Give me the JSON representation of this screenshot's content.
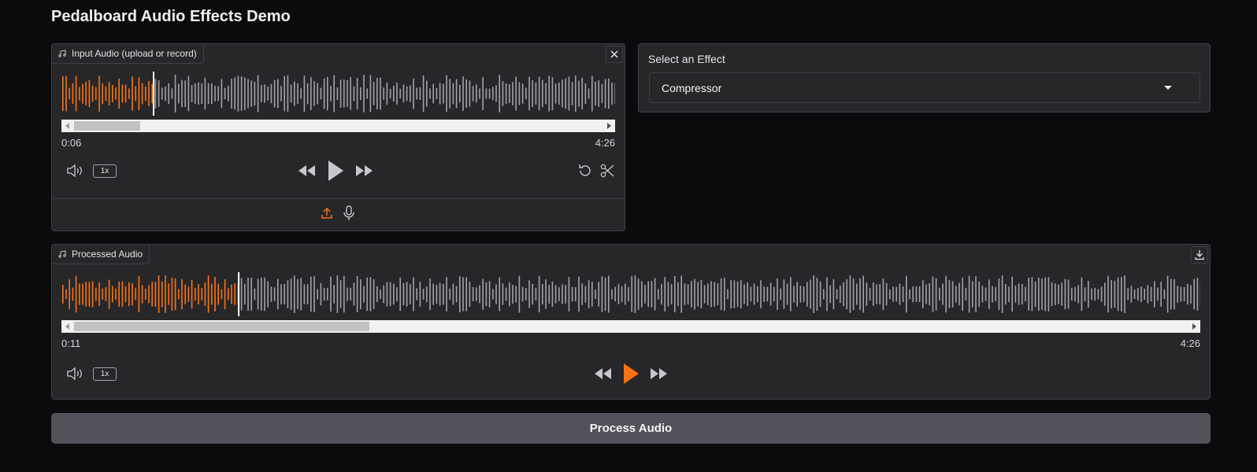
{
  "page": {
    "title": "Pedalboard Audio Effects Demo"
  },
  "colors": {
    "accent": "#f97316",
    "played": "#f97316",
    "unplayed": "#a1a1aa",
    "panel": "#27272a",
    "background": "#0b0b0d"
  },
  "input_audio": {
    "label": "Input Audio (upload or record)",
    "label_icon": "music-note-icon",
    "clear_icon": "close-icon",
    "current_time": "0:06",
    "duration": "4:26",
    "playback_rate": "1x",
    "played_fraction": 0.165,
    "scroll_thumb_fraction": 0.125,
    "controls": [
      "volume-icon",
      "skip-backward-icon",
      "play-icon",
      "skip-forward-icon",
      "undo-icon",
      "trim-scissors-icon"
    ],
    "sources": [
      "upload-icon",
      "microphone-icon"
    ]
  },
  "effect_select": {
    "label": "Select an Effect",
    "selected": "Compressor"
  },
  "processed_audio": {
    "label": "Processed Audio",
    "label_icon": "music-note-icon",
    "download_icon": "download-icon",
    "current_time": "0:11",
    "duration": "4:26",
    "playback_rate": "1x",
    "played_fraction": 0.155,
    "scroll_thumb_fraction": 0.265,
    "controls": [
      "volume-icon",
      "skip-backward-icon",
      "play-icon",
      "skip-forward-icon"
    ]
  },
  "process_button": {
    "label": "Process Audio"
  }
}
